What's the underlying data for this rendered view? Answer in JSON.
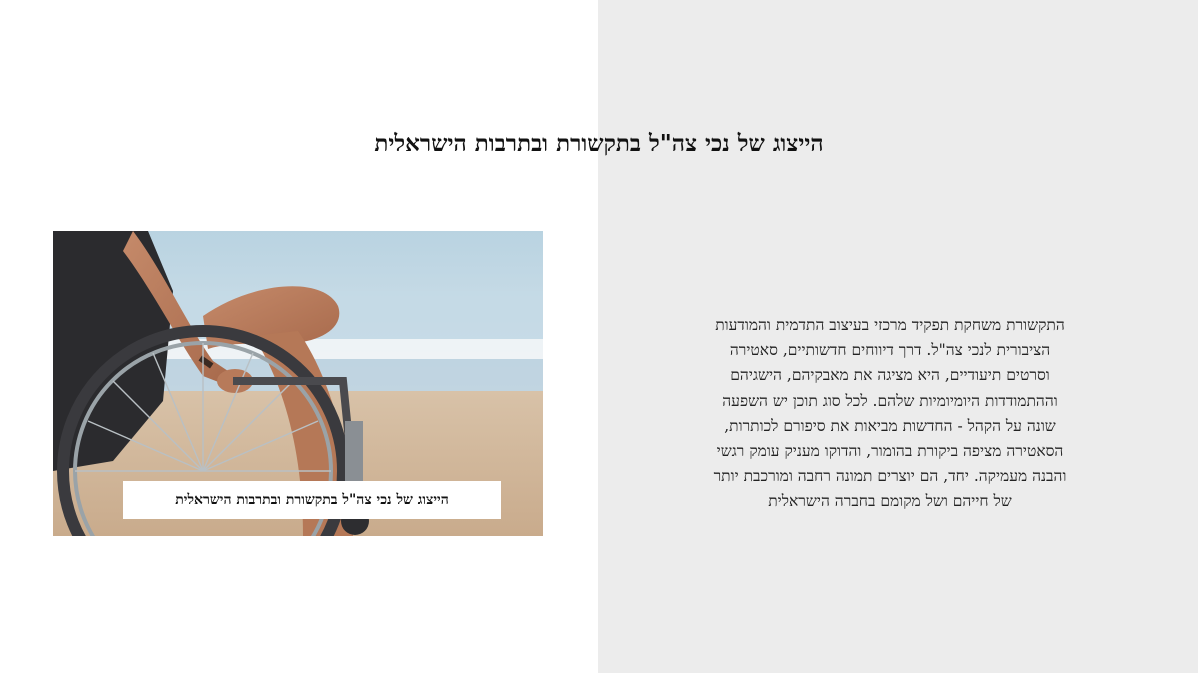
{
  "slide": {
    "title": "הייצוג של נכי צה\"ל בתקשורת ובתרבות הישראלית",
    "image_caption": "הייצוג של נכי צה\"ל בתקשורת ובתרבות הישראלית",
    "body_lines": [
      "התקשורת משחקת תפקיד מרכזי בעיצוב התדמית והמודעות",
      "הציבורית לנכי צה\"ל. דרך דיווחים חדשותיים, סאטירה",
      "וסרטים תיעודיים, היא מציגה את מאבקיהם, הישגיהם",
      "וההתמודדות היומיומיות שלהם. לכל סוג תוכן יש השפעה",
      "שונה על הקהל - החדשות מביאות את סיפורם לכותרות,",
      "הסאטירה מציפה ביקורת בהומור, והדוקו מעניק עומק רגשי",
      "והבנה מעמיקה. יחד, הם יוצרים תמונה רחבה ומורכבת יותר",
      "של חייהם ושל מקומם בחברה הישראלית"
    ]
  },
  "colors": {
    "right_panel": "#ececec",
    "text": "#111111"
  }
}
